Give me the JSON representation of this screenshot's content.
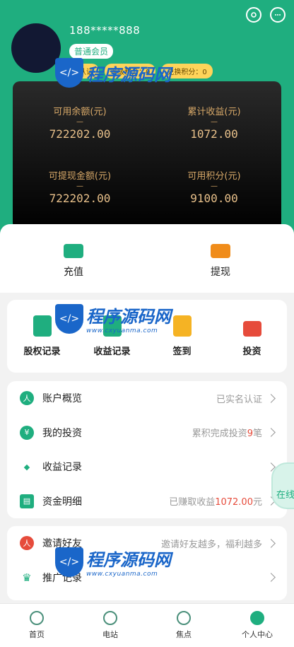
{
  "header": {
    "phone": "188*****888",
    "member_level": "普通会员",
    "badges": [
      "认证",
      "等级积分：0",
      "兑换积分：0"
    ]
  },
  "stats": [
    {
      "label": "可用余额(元)",
      "value": "722202.00"
    },
    {
      "label": "累计收益(元)",
      "value": "1072.00"
    },
    {
      "label": "可提现金额(元)",
      "value": "722202.00"
    },
    {
      "label": "可用积分(元)",
      "value": "9100.00"
    }
  ],
  "stat_dash": "—",
  "actions": [
    {
      "label": "充值",
      "icon": "wallet-card-icon",
      "color": "#1fae7f"
    },
    {
      "label": "提现",
      "icon": "wallet-icon",
      "color": "#f08c1a"
    }
  ],
  "grid": [
    {
      "label": "股权记录",
      "icon": "chart-calendar-icon",
      "color": "#1fae7f"
    },
    {
      "label": "收益记录",
      "icon": "income-icon",
      "color": "#1fae7f"
    },
    {
      "label": "签到",
      "icon": "checkin-calendar-icon",
      "color": "#f5b324"
    },
    {
      "label": "投资",
      "icon": "truck-icon",
      "color": "#e64b3b"
    }
  ],
  "list1": [
    {
      "label": "账户概览",
      "right": "已实名认证",
      "icon_text": "人"
    },
    {
      "label": "我的投资",
      "right_prefix": "累积完成投资",
      "right_highlight": "9",
      "right_suffix": "笔",
      "icon_text": "¥"
    },
    {
      "label": "收益记录",
      "right": "",
      "icon_text": "◆"
    },
    {
      "label": "资金明细",
      "right_prefix": "已赚取收益",
      "right_highlight": "1072.00",
      "right_suffix": "元",
      "icon_text": "▤"
    }
  ],
  "list2": [
    {
      "label": "邀请好友",
      "right": "邀请好友越多，福利越多",
      "icon_text": "人"
    },
    {
      "label": "推广记录",
      "right": "",
      "icon_text": "♛"
    }
  ],
  "online_label": "在线",
  "nav": [
    {
      "label": "首页"
    },
    {
      "label": "电站"
    },
    {
      "label": "焦点"
    },
    {
      "label": "个人中心"
    }
  ],
  "watermark": {
    "title": "程序源码网",
    "sub": "www.cxyuanma.com",
    "logo": "</>"
  },
  "colors": {
    "primary": "#1fae7f",
    "gold": "#d7a868",
    "highlight": "#e64b3b"
  }
}
